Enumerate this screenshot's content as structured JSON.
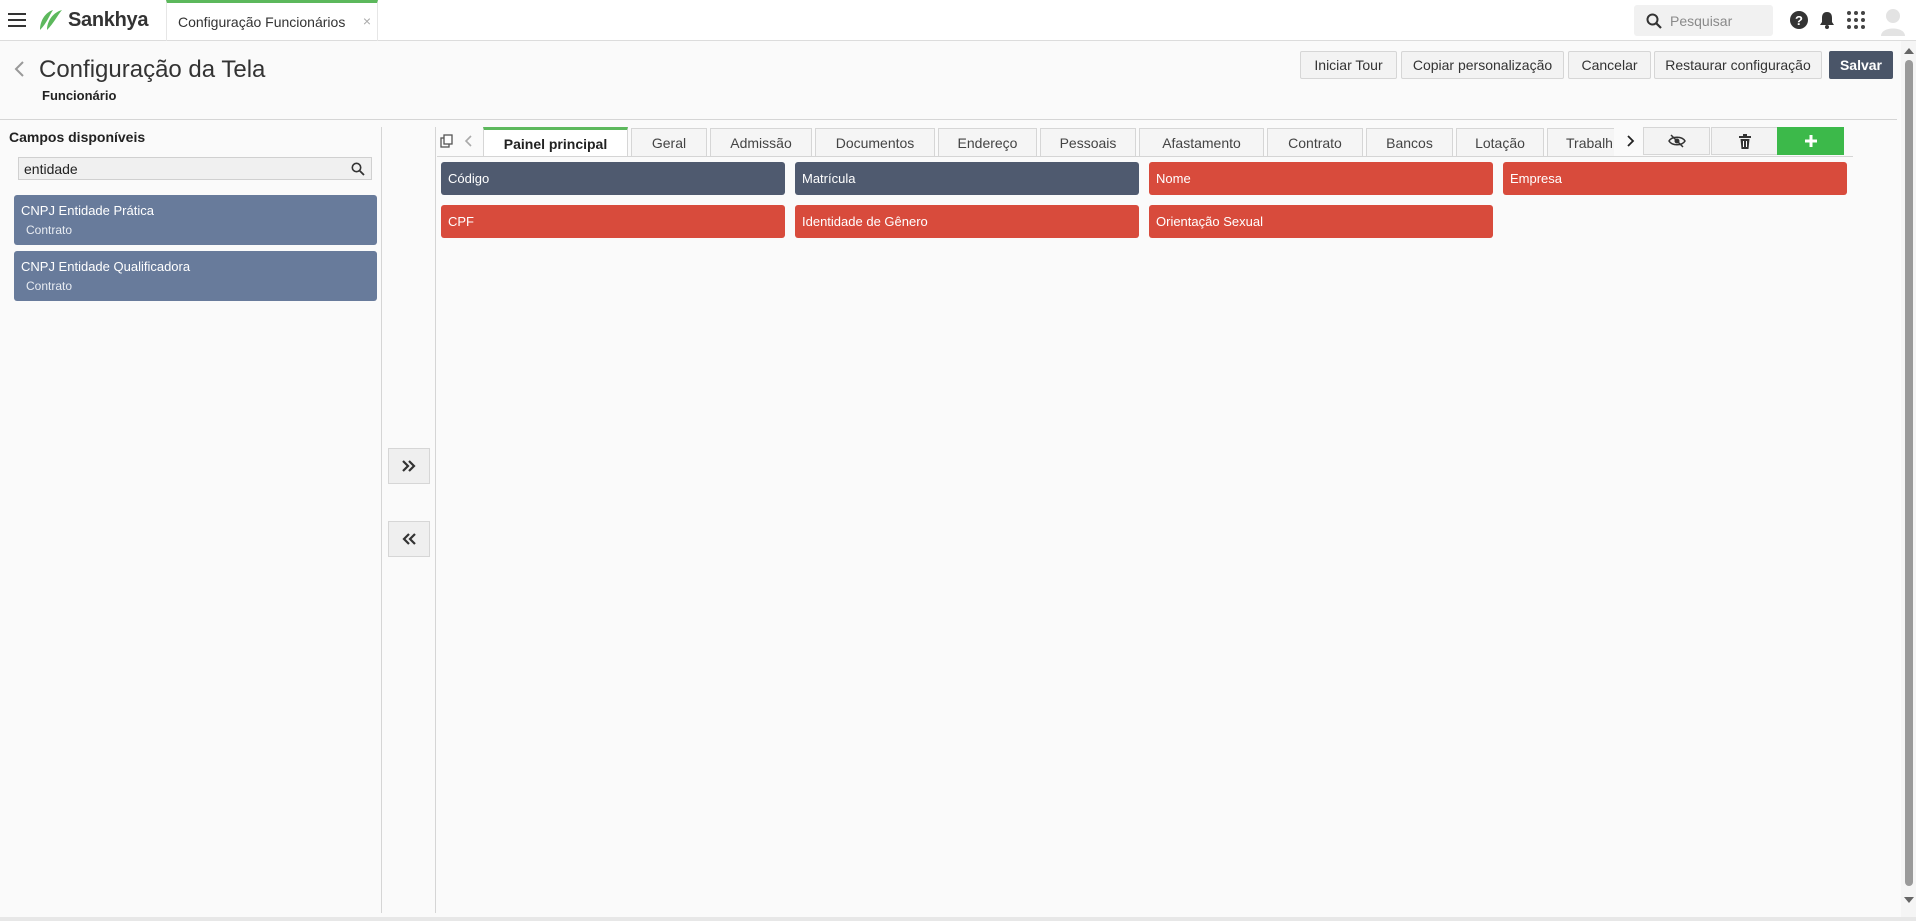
{
  "topbar": {
    "logo_text": "Sankhya",
    "app_tab_label": "Configuração Funcionários",
    "close_glyph": "×",
    "search_placeholder": "Pesquisar",
    "icons": [
      "menu-icon",
      "help-icon",
      "bell-icon",
      "apps-grid-icon",
      "user-avatar"
    ]
  },
  "header": {
    "title": "Configuração da Tela",
    "subtitle": "Funcionário",
    "buttons": {
      "tour": "Iniciar Tour",
      "copy": "Copiar personalização",
      "cancel": "Cancelar",
      "restore": "Restaurar configuração",
      "save": "Salvar"
    }
  },
  "left_panel": {
    "title": "Campos disponíveis",
    "search_value": "entidade",
    "fields": [
      {
        "name": "CNPJ Entidade Prática",
        "group": "Contrato"
      },
      {
        "name": "CNPJ Entidade Qualificadora",
        "group": "Contrato"
      }
    ]
  },
  "tabs": [
    "Painel principal",
    "Geral",
    "Admissão",
    "Documentos",
    "Endereço",
    "Pessoais",
    "Afastamento",
    "Contrato",
    "Bancos",
    "Lotação",
    "Trabalh"
  ],
  "active_tab": "Painel principal",
  "grid_fields": [
    {
      "label": "Código",
      "style": "dark"
    },
    {
      "label": "Matrícula",
      "style": "dark"
    },
    {
      "label": "Nome",
      "style": "red"
    },
    {
      "label": "Empresa",
      "style": "red"
    },
    {
      "label": "CPF",
      "style": "red"
    },
    {
      "label": "Identidade de Gênero",
      "style": "red"
    },
    {
      "label": "Orientação Sexual",
      "style": "red"
    }
  ],
  "colors": {
    "accent_green": "#5cb85c",
    "add_button_green": "#3cb94a",
    "field_card": "#687b9b",
    "field_dark": "#4f5a6f",
    "field_required_red": "#d84b3c",
    "save_button": "#4a5568"
  }
}
